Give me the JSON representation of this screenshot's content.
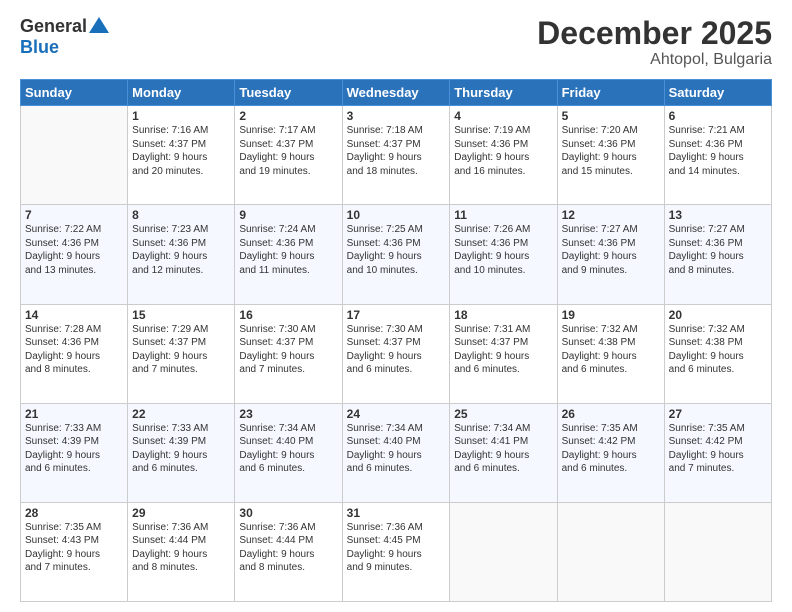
{
  "logo": {
    "general": "General",
    "blue": "Blue"
  },
  "title": "December 2025",
  "subtitle": "Ahtopol, Bulgaria",
  "calendar": {
    "headers": [
      "Sunday",
      "Monday",
      "Tuesday",
      "Wednesday",
      "Thursday",
      "Friday",
      "Saturday"
    ],
    "rows": [
      [
        {
          "day": "",
          "info": ""
        },
        {
          "day": "1",
          "info": "Sunrise: 7:16 AM\nSunset: 4:37 PM\nDaylight: 9 hours\nand 20 minutes."
        },
        {
          "day": "2",
          "info": "Sunrise: 7:17 AM\nSunset: 4:37 PM\nDaylight: 9 hours\nand 19 minutes."
        },
        {
          "day": "3",
          "info": "Sunrise: 7:18 AM\nSunset: 4:37 PM\nDaylight: 9 hours\nand 18 minutes."
        },
        {
          "day": "4",
          "info": "Sunrise: 7:19 AM\nSunset: 4:36 PM\nDaylight: 9 hours\nand 16 minutes."
        },
        {
          "day": "5",
          "info": "Sunrise: 7:20 AM\nSunset: 4:36 PM\nDaylight: 9 hours\nand 15 minutes."
        },
        {
          "day": "6",
          "info": "Sunrise: 7:21 AM\nSunset: 4:36 PM\nDaylight: 9 hours\nand 14 minutes."
        }
      ],
      [
        {
          "day": "7",
          "info": "Sunrise: 7:22 AM\nSunset: 4:36 PM\nDaylight: 9 hours\nand 13 minutes."
        },
        {
          "day": "8",
          "info": "Sunrise: 7:23 AM\nSunset: 4:36 PM\nDaylight: 9 hours\nand 12 minutes."
        },
        {
          "day": "9",
          "info": "Sunrise: 7:24 AM\nSunset: 4:36 PM\nDaylight: 9 hours\nand 11 minutes."
        },
        {
          "day": "10",
          "info": "Sunrise: 7:25 AM\nSunset: 4:36 PM\nDaylight: 9 hours\nand 10 minutes."
        },
        {
          "day": "11",
          "info": "Sunrise: 7:26 AM\nSunset: 4:36 PM\nDaylight: 9 hours\nand 10 minutes."
        },
        {
          "day": "12",
          "info": "Sunrise: 7:27 AM\nSunset: 4:36 PM\nDaylight: 9 hours\nand 9 minutes."
        },
        {
          "day": "13",
          "info": "Sunrise: 7:27 AM\nSunset: 4:36 PM\nDaylight: 9 hours\nand 8 minutes."
        }
      ],
      [
        {
          "day": "14",
          "info": "Sunrise: 7:28 AM\nSunset: 4:36 PM\nDaylight: 9 hours\nand 8 minutes."
        },
        {
          "day": "15",
          "info": "Sunrise: 7:29 AM\nSunset: 4:37 PM\nDaylight: 9 hours\nand 7 minutes."
        },
        {
          "day": "16",
          "info": "Sunrise: 7:30 AM\nSunset: 4:37 PM\nDaylight: 9 hours\nand 7 minutes."
        },
        {
          "day": "17",
          "info": "Sunrise: 7:30 AM\nSunset: 4:37 PM\nDaylight: 9 hours\nand 6 minutes."
        },
        {
          "day": "18",
          "info": "Sunrise: 7:31 AM\nSunset: 4:37 PM\nDaylight: 9 hours\nand 6 minutes."
        },
        {
          "day": "19",
          "info": "Sunrise: 7:32 AM\nSunset: 4:38 PM\nDaylight: 9 hours\nand 6 minutes."
        },
        {
          "day": "20",
          "info": "Sunrise: 7:32 AM\nSunset: 4:38 PM\nDaylight: 9 hours\nand 6 minutes."
        }
      ],
      [
        {
          "day": "21",
          "info": "Sunrise: 7:33 AM\nSunset: 4:39 PM\nDaylight: 9 hours\nand 6 minutes."
        },
        {
          "day": "22",
          "info": "Sunrise: 7:33 AM\nSunset: 4:39 PM\nDaylight: 9 hours\nand 6 minutes."
        },
        {
          "day": "23",
          "info": "Sunrise: 7:34 AM\nSunset: 4:40 PM\nDaylight: 9 hours\nand 6 minutes."
        },
        {
          "day": "24",
          "info": "Sunrise: 7:34 AM\nSunset: 4:40 PM\nDaylight: 9 hours\nand 6 minutes."
        },
        {
          "day": "25",
          "info": "Sunrise: 7:34 AM\nSunset: 4:41 PM\nDaylight: 9 hours\nand 6 minutes."
        },
        {
          "day": "26",
          "info": "Sunrise: 7:35 AM\nSunset: 4:42 PM\nDaylight: 9 hours\nand 6 minutes."
        },
        {
          "day": "27",
          "info": "Sunrise: 7:35 AM\nSunset: 4:42 PM\nDaylight: 9 hours\nand 7 minutes."
        }
      ],
      [
        {
          "day": "28",
          "info": "Sunrise: 7:35 AM\nSunset: 4:43 PM\nDaylight: 9 hours\nand 7 minutes."
        },
        {
          "day": "29",
          "info": "Sunrise: 7:36 AM\nSunset: 4:44 PM\nDaylight: 9 hours\nand 8 minutes."
        },
        {
          "day": "30",
          "info": "Sunrise: 7:36 AM\nSunset: 4:44 PM\nDaylight: 9 hours\nand 8 minutes."
        },
        {
          "day": "31",
          "info": "Sunrise: 7:36 AM\nSunset: 4:45 PM\nDaylight: 9 hours\nand 9 minutes."
        },
        {
          "day": "",
          "info": ""
        },
        {
          "day": "",
          "info": ""
        },
        {
          "day": "",
          "info": ""
        }
      ]
    ]
  }
}
